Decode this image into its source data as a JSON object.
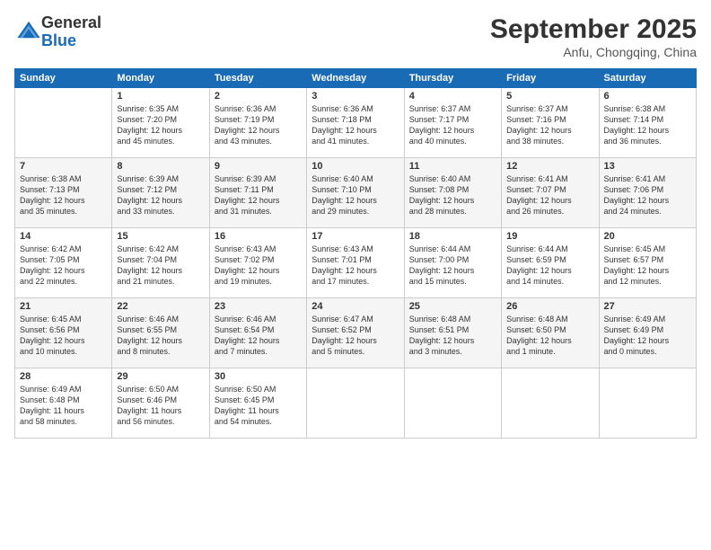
{
  "logo": {
    "general": "General",
    "blue": "Blue"
  },
  "header": {
    "month": "September 2025",
    "location": "Anfu, Chongqing, China"
  },
  "weekdays": [
    "Sunday",
    "Monday",
    "Tuesday",
    "Wednesday",
    "Thursday",
    "Friday",
    "Saturday"
  ],
  "weeks": [
    [
      {
        "day": "",
        "info": ""
      },
      {
        "day": "1",
        "info": "Sunrise: 6:35 AM\nSunset: 7:20 PM\nDaylight: 12 hours\nand 45 minutes."
      },
      {
        "day": "2",
        "info": "Sunrise: 6:36 AM\nSunset: 7:19 PM\nDaylight: 12 hours\nand 43 minutes."
      },
      {
        "day": "3",
        "info": "Sunrise: 6:36 AM\nSunset: 7:18 PM\nDaylight: 12 hours\nand 41 minutes."
      },
      {
        "day": "4",
        "info": "Sunrise: 6:37 AM\nSunset: 7:17 PM\nDaylight: 12 hours\nand 40 minutes."
      },
      {
        "day": "5",
        "info": "Sunrise: 6:37 AM\nSunset: 7:16 PM\nDaylight: 12 hours\nand 38 minutes."
      },
      {
        "day": "6",
        "info": "Sunrise: 6:38 AM\nSunset: 7:14 PM\nDaylight: 12 hours\nand 36 minutes."
      }
    ],
    [
      {
        "day": "7",
        "info": "Sunrise: 6:38 AM\nSunset: 7:13 PM\nDaylight: 12 hours\nand 35 minutes."
      },
      {
        "day": "8",
        "info": "Sunrise: 6:39 AM\nSunset: 7:12 PM\nDaylight: 12 hours\nand 33 minutes."
      },
      {
        "day": "9",
        "info": "Sunrise: 6:39 AM\nSunset: 7:11 PM\nDaylight: 12 hours\nand 31 minutes."
      },
      {
        "day": "10",
        "info": "Sunrise: 6:40 AM\nSunset: 7:10 PM\nDaylight: 12 hours\nand 29 minutes."
      },
      {
        "day": "11",
        "info": "Sunrise: 6:40 AM\nSunset: 7:08 PM\nDaylight: 12 hours\nand 28 minutes."
      },
      {
        "day": "12",
        "info": "Sunrise: 6:41 AM\nSunset: 7:07 PM\nDaylight: 12 hours\nand 26 minutes."
      },
      {
        "day": "13",
        "info": "Sunrise: 6:41 AM\nSunset: 7:06 PM\nDaylight: 12 hours\nand 24 minutes."
      }
    ],
    [
      {
        "day": "14",
        "info": "Sunrise: 6:42 AM\nSunset: 7:05 PM\nDaylight: 12 hours\nand 22 minutes."
      },
      {
        "day": "15",
        "info": "Sunrise: 6:42 AM\nSunset: 7:04 PM\nDaylight: 12 hours\nand 21 minutes."
      },
      {
        "day": "16",
        "info": "Sunrise: 6:43 AM\nSunset: 7:02 PM\nDaylight: 12 hours\nand 19 minutes."
      },
      {
        "day": "17",
        "info": "Sunrise: 6:43 AM\nSunset: 7:01 PM\nDaylight: 12 hours\nand 17 minutes."
      },
      {
        "day": "18",
        "info": "Sunrise: 6:44 AM\nSunset: 7:00 PM\nDaylight: 12 hours\nand 15 minutes."
      },
      {
        "day": "19",
        "info": "Sunrise: 6:44 AM\nSunset: 6:59 PM\nDaylight: 12 hours\nand 14 minutes."
      },
      {
        "day": "20",
        "info": "Sunrise: 6:45 AM\nSunset: 6:57 PM\nDaylight: 12 hours\nand 12 minutes."
      }
    ],
    [
      {
        "day": "21",
        "info": "Sunrise: 6:45 AM\nSunset: 6:56 PM\nDaylight: 12 hours\nand 10 minutes."
      },
      {
        "day": "22",
        "info": "Sunrise: 6:46 AM\nSunset: 6:55 PM\nDaylight: 12 hours\nand 8 minutes."
      },
      {
        "day": "23",
        "info": "Sunrise: 6:46 AM\nSunset: 6:54 PM\nDaylight: 12 hours\nand 7 minutes."
      },
      {
        "day": "24",
        "info": "Sunrise: 6:47 AM\nSunset: 6:52 PM\nDaylight: 12 hours\nand 5 minutes."
      },
      {
        "day": "25",
        "info": "Sunrise: 6:48 AM\nSunset: 6:51 PM\nDaylight: 12 hours\nand 3 minutes."
      },
      {
        "day": "26",
        "info": "Sunrise: 6:48 AM\nSunset: 6:50 PM\nDaylight: 12 hours\nand 1 minute."
      },
      {
        "day": "27",
        "info": "Sunrise: 6:49 AM\nSunset: 6:49 PM\nDaylight: 12 hours\nand 0 minutes."
      }
    ],
    [
      {
        "day": "28",
        "info": "Sunrise: 6:49 AM\nSunset: 6:48 PM\nDaylight: 11 hours\nand 58 minutes."
      },
      {
        "day": "29",
        "info": "Sunrise: 6:50 AM\nSunset: 6:46 PM\nDaylight: 11 hours\nand 56 minutes."
      },
      {
        "day": "30",
        "info": "Sunrise: 6:50 AM\nSunset: 6:45 PM\nDaylight: 11 hours\nand 54 minutes."
      },
      {
        "day": "",
        "info": ""
      },
      {
        "day": "",
        "info": ""
      },
      {
        "day": "",
        "info": ""
      },
      {
        "day": "",
        "info": ""
      }
    ]
  ]
}
